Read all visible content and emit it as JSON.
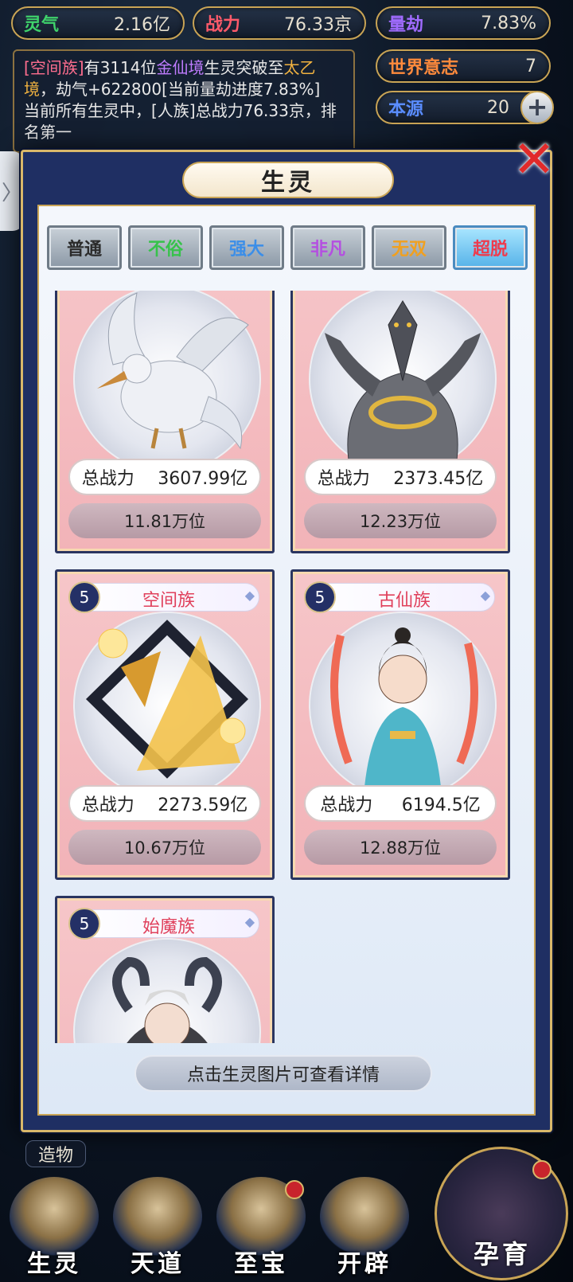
{
  "stats": {
    "lingqi": {
      "label": "灵气",
      "value": "2.16亿",
      "color": "#3fd26b"
    },
    "zhanli": {
      "label": "战力",
      "value": "76.33京",
      "color": "#ff5a6a"
    },
    "liangjie": {
      "label": "量劫",
      "value": "7.83%",
      "color": "#a06bff"
    },
    "shijie": {
      "label": "世界意志",
      "value": "7",
      "color": "#ff8a3c"
    },
    "benyuan": {
      "label": "本源",
      "value": "20",
      "color": "#5a8dff"
    }
  },
  "log": {
    "p1": "[空间族]",
    "p2": "有3114位",
    "p3": "金仙境",
    "p4": "生灵突破至",
    "p5": "太乙境",
    "p6": "，劫气+622800[当前量劫进度7.83%]",
    "p7": "当前所有生灵中，[人族]总战力76.33京，排名第一"
  },
  "modal": {
    "title": "生灵"
  },
  "tabs": [
    {
      "label": "普通",
      "color": "#2b2b2b"
    },
    {
      "label": "不俗",
      "color": "#37c24b"
    },
    {
      "label": "强大",
      "color": "#3b8ee8"
    },
    {
      "label": "非凡",
      "color": "#b44fe0"
    },
    {
      "label": "无双",
      "color": "#f0a020"
    },
    {
      "label": "超脱",
      "color": "#ee3b4d"
    }
  ],
  "power_label": "总战力",
  "cards": [
    {
      "level": "",
      "race": "",
      "power": "3607.99亿",
      "rank": "11.81万位",
      "creature": "bird"
    },
    {
      "level": "",
      "race": "",
      "power": "2373.45亿",
      "rank": "12.23万位",
      "creature": "hydra"
    },
    {
      "level": "5",
      "race": "空间族",
      "power": "2273.59亿",
      "rank": "10.67万位",
      "creature": "prism"
    },
    {
      "level": "5",
      "race": "古仙族",
      "power": "6194.5亿",
      "rank": "12.88万位",
      "creature": "fairy"
    },
    {
      "level": "5",
      "race": "始魔族",
      "power": "",
      "rank": "",
      "creature": "demon"
    }
  ],
  "hint": "点击生灵图片可查看详情",
  "nav": {
    "zaowu": "造物",
    "shengling": "生灵",
    "tiandao": "天道",
    "zhibao": "至宝",
    "kaipi": "开辟",
    "yunyu": "孕育"
  },
  "icons": {
    "close": "close-icon",
    "plus": "plus-icon",
    "side": "chevron-right-icon"
  }
}
